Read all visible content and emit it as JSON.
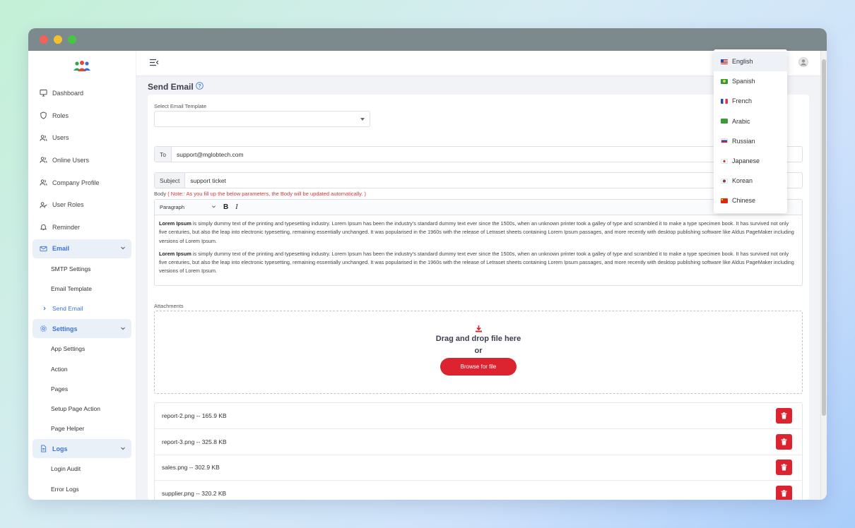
{
  "sidebar": {
    "items": [
      {
        "label": "Dashboard"
      },
      {
        "label": "Roles"
      },
      {
        "label": "Users"
      },
      {
        "label": "Online Users"
      },
      {
        "label": "Company Profile"
      },
      {
        "label": "User Roles"
      },
      {
        "label": "Reminder"
      }
    ],
    "email_group": {
      "label": "Email",
      "children": [
        "SMTP Settings",
        "Email Template",
        "Send Email"
      ]
    },
    "settings_group": {
      "label": "Settings",
      "children": [
        "App Settings",
        "Action",
        "Pages",
        "Setup Page Action",
        "Page Helper"
      ]
    },
    "logs_group": {
      "label": "Logs",
      "children": [
        "Login Audit",
        "Error Logs"
      ]
    }
  },
  "page": {
    "title": "Send Email",
    "template_label": "Select Email Template",
    "to_label": "To",
    "to_value": "support@mglobtech.com",
    "subject_label": "Subject",
    "subject_value": "support ticket",
    "body_label": "Body",
    "body_note": "( Note:: As you fill up the below parameters, the Body will be updated automatically. )",
    "editor": {
      "format": "Paragraph",
      "bold": "B",
      "italic": "I",
      "para_bold": "Lorem Ipsum",
      "para_text": " is simply dummy text of the printing and typesetting industry. Lorem Ipsum has been the industry's standard dummy text ever since the 1500s, when an unknown printer took a galley of type and scrambled it to make a type specimen book. It has survived not only five centuries, but also the leap into electronic typesetting, remaining essentially unchanged. It was popularised in the 1960s with the release of Letraset sheets containing Lorem Ipsum passages, and more recently with desktop publishing software like Aldus PageMaker including versions of Lorem Ipsum."
    },
    "attachments_label": "Attachments",
    "dropzone": {
      "title": "Drag and drop file here",
      "or": "or",
      "button": "Browse for file"
    },
    "files": [
      {
        "name": "report-2.png -- 165.9 KB"
      },
      {
        "name": "report-3.png -- 325.8 KB"
      },
      {
        "name": "sales.png -- 302.9 KB"
      },
      {
        "name": "supplier.png -- 320.2 KB"
      }
    ]
  },
  "languages": [
    {
      "label": "English",
      "flag": "us"
    },
    {
      "label": "Spanish",
      "flag": "br"
    },
    {
      "label": "French",
      "flag": "fr"
    },
    {
      "label": "Arabic",
      "flag": "sa"
    },
    {
      "label": "Russian",
      "flag": "ru"
    },
    {
      "label": "Japanese",
      "flag": "jp"
    },
    {
      "label": "Korean",
      "flag": "kr"
    },
    {
      "label": "Chinese",
      "flag": "cn"
    }
  ],
  "colors": {
    "accent": "#3d73d9",
    "danger": "#dc2430"
  }
}
